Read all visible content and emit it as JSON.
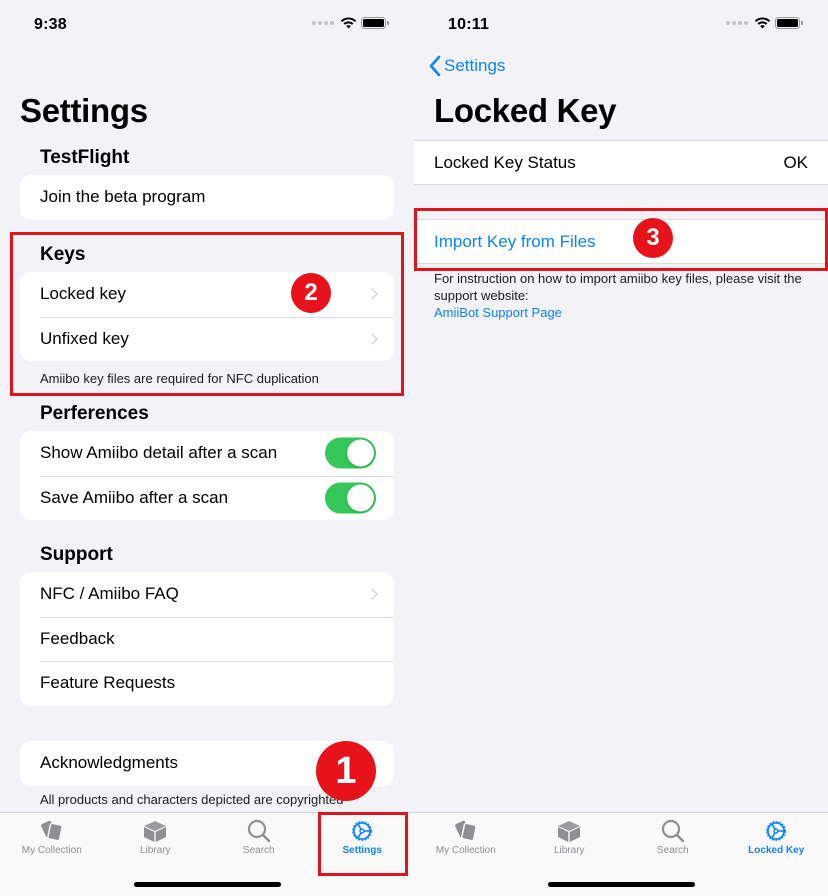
{
  "colors": {
    "accent": "#0a84ff",
    "toggle_on": "#34c759",
    "annotation_red": "#e0141b",
    "background": "#f2f2f7"
  },
  "left": {
    "status_bar": {
      "time": "9:38",
      "icons": [
        "signal-dots-icon",
        "wifi-icon",
        "battery-icon"
      ]
    },
    "title": "Settings",
    "sections": {
      "testflight": {
        "header": "TestFlight",
        "rows": [
          {
            "label": "Join the beta program"
          }
        ]
      },
      "keys": {
        "header": "Keys",
        "rows": [
          {
            "label": "Locked key",
            "accessory": "chevron-right-icon"
          },
          {
            "label": "Unfixed key",
            "accessory": "chevron-right-icon"
          }
        ],
        "footer": "Amiibo key files are required for NFC duplication"
      },
      "preferences": {
        "header": "Perferences",
        "rows": [
          {
            "label": "Show Amiibo detail after a scan",
            "toggle_on": true
          },
          {
            "label": "Save Amiibo after a scan",
            "toggle_on": true
          }
        ]
      },
      "support": {
        "header": "Support",
        "rows": [
          {
            "label": "NFC / Amiibo FAQ",
            "accessory": "chevron-right-icon"
          },
          {
            "label": "Feedback"
          },
          {
            "label": "Feature Requests"
          }
        ]
      },
      "acknowledgments": {
        "rows": [
          {
            "label": "Acknowledgments"
          }
        ],
        "footer": "All products and characters depicted are copyrighted"
      }
    },
    "tab_bar": {
      "tabs": [
        {
          "label": "My Collection",
          "icon": "cards-icon",
          "active": false
        },
        {
          "label": "Library",
          "icon": "box-icon",
          "active": false
        },
        {
          "label": "Search",
          "icon": "search-icon",
          "active": false
        },
        {
          "label": "Settings",
          "icon": "gear-icon",
          "active": true
        }
      ]
    },
    "annotations": {
      "badge_1": "1",
      "badge_2": "2"
    }
  },
  "right": {
    "status_bar": {
      "time": "10:11",
      "icons": [
        "signal-dots-icon",
        "wifi-icon",
        "battery-icon"
      ]
    },
    "nav": {
      "back_label": "Settings"
    },
    "title": "Locked Key",
    "status_row": {
      "label": "Locked Key Status",
      "value": "OK"
    },
    "import_row": {
      "label": "Import Key from Files"
    },
    "footer": {
      "text": "For instruction on how to import amiibo key files, please visit the support website:",
      "link": "AmiiBot Support Page"
    },
    "tab_bar": {
      "tabs": [
        {
          "label": "My Collection",
          "icon": "cards-icon",
          "active": false
        },
        {
          "label": "Library",
          "icon": "box-icon",
          "active": false
        },
        {
          "label": "Search",
          "icon": "search-icon",
          "active": false
        },
        {
          "label": "Locked Key",
          "icon": "gear-icon",
          "active": true
        }
      ]
    },
    "annotations": {
      "badge_3": "3"
    }
  }
}
